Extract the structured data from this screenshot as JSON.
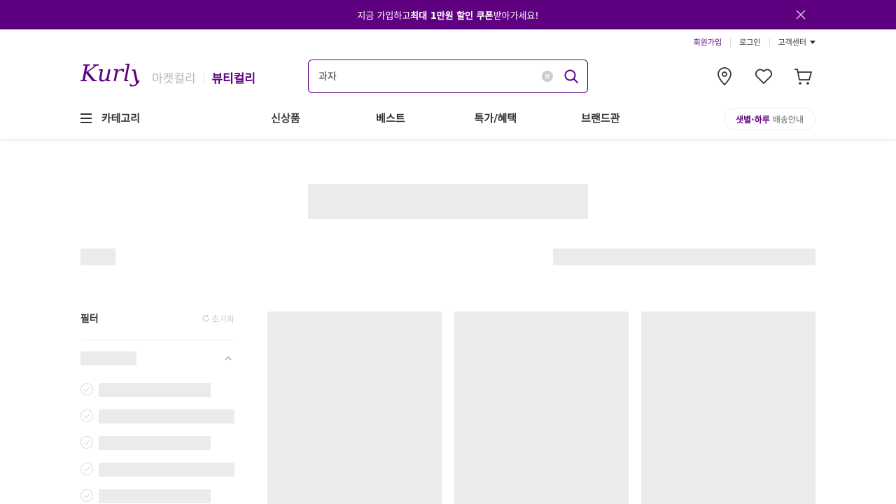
{
  "banner": {
    "prefix": "지금 가입하고 ",
    "highlight": "최대 1만원 할인 쿠폰",
    "suffix": " 받아가세요!"
  },
  "util_menu": {
    "join": "회원가입",
    "login": "로그인",
    "customer_center": "고객센터"
  },
  "brand": {
    "logo_text": "Kurly",
    "market_tab": "마켓컬리",
    "beauty_tab": "뷰티컬리"
  },
  "search": {
    "value": "과자"
  },
  "gnb": {
    "category": "카테고리",
    "menu": [
      "신상품",
      "베스트",
      "특가/혜택",
      "브랜드관"
    ],
    "delivery_highlight": "샛별·하루",
    "delivery_text": "배송안내"
  },
  "filter": {
    "title": "필터",
    "reset": "초기화"
  },
  "colors": {
    "brand_purple": "#5f0080",
    "skeleton": "#ebebeb"
  }
}
